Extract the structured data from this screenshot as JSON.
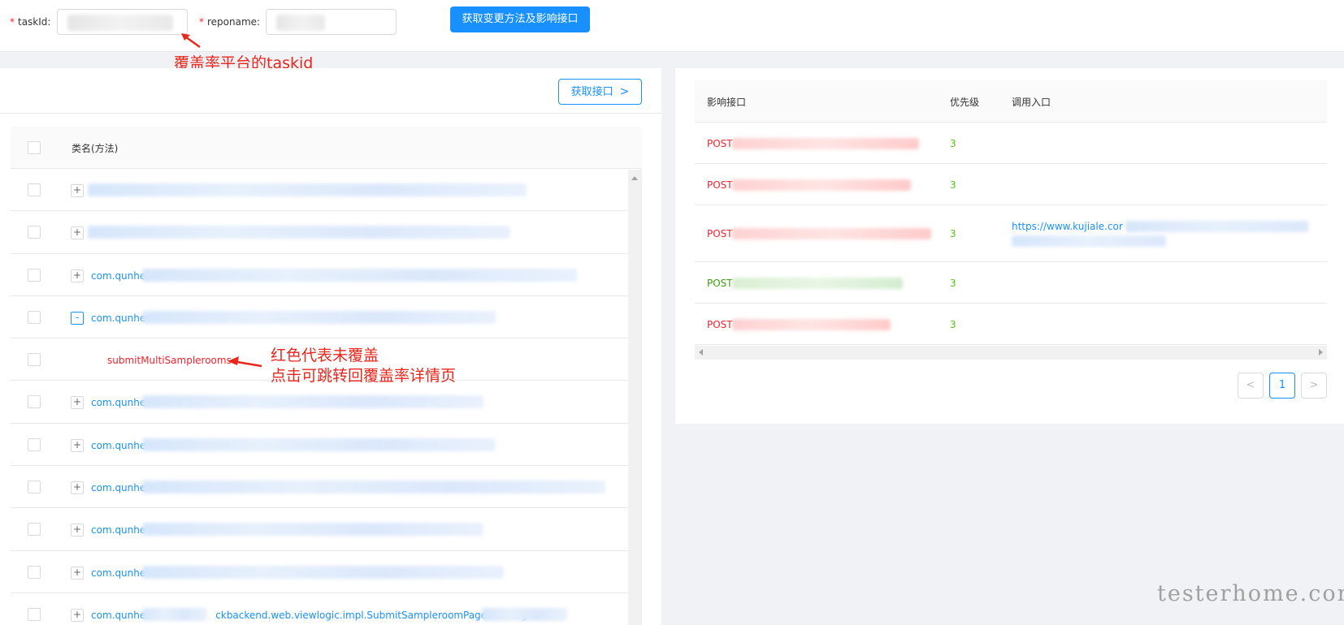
{
  "form": {
    "taskid_label": "taskId",
    "reponame_label": "reponame",
    "required_mark": "*",
    "submit_label": "获取变更方法及影响接口"
  },
  "annotations": {
    "taskid_note": "覆盖率平台的taskid",
    "red_note_line1": "红色代表未覆盖",
    "red_note_line2": "点击可跳转回覆盖率详情页",
    "annotation_color": "#e8261c"
  },
  "left": {
    "fetch_label": "获取接口",
    "header": "类名(方法)",
    "rows": [
      {
        "type": "pkg",
        "expander": "+",
        "text": ""
      },
      {
        "type": "pkg",
        "expander": "+",
        "text": ""
      },
      {
        "type": "pkg",
        "expander": "+",
        "text": "com.qunhe"
      },
      {
        "type": "pkg",
        "expander": "-",
        "text": "com.qunhe"
      },
      {
        "type": "method",
        "expander": "",
        "text": "submitMultiSamplerooms"
      },
      {
        "type": "pkg",
        "expander": "+",
        "text": "com.qunhe"
      },
      {
        "type": "pkg",
        "expander": "+",
        "text": "com.qunhe"
      },
      {
        "type": "pkg",
        "expander": "+",
        "text": "com.qunhe"
      },
      {
        "type": "pkg",
        "expander": "+",
        "text": "com.qunhe"
      },
      {
        "type": "pkg",
        "expander": "+",
        "text": "com.qunhe"
      },
      {
        "type": "pkg",
        "expander": "+",
        "text": "com.qunhe",
        "suffix": "ckbackend.web.viewlogic.impl.SubmitSampleroomPageViewLogicI"
      }
    ]
  },
  "right": {
    "headers": [
      "影响接口",
      "优先级",
      "调用入口"
    ],
    "rows": [
      {
        "method": "POST",
        "priority": "3",
        "entry": "",
        "color": "#f5222d"
      },
      {
        "method": "POST",
        "priority": "3",
        "entry": "",
        "color": "#f5222d"
      },
      {
        "method": "POST",
        "priority": "3",
        "entry": "https://www.kujiale.cor",
        "color": "#f5222d"
      },
      {
        "method": "POST",
        "priority": "3",
        "entry": "",
        "color": "#389e0d"
      },
      {
        "method": "POST",
        "priority": "3",
        "entry": "",
        "color": "#f5222d"
      }
    ],
    "pagination": {
      "prev": "<",
      "current": "1",
      "next": ">"
    }
  },
  "watermark": "testerhome.com",
  "colors": {
    "primary": "#1890ff",
    "uncovered": "#f5222d",
    "covered": "#52c41a"
  }
}
